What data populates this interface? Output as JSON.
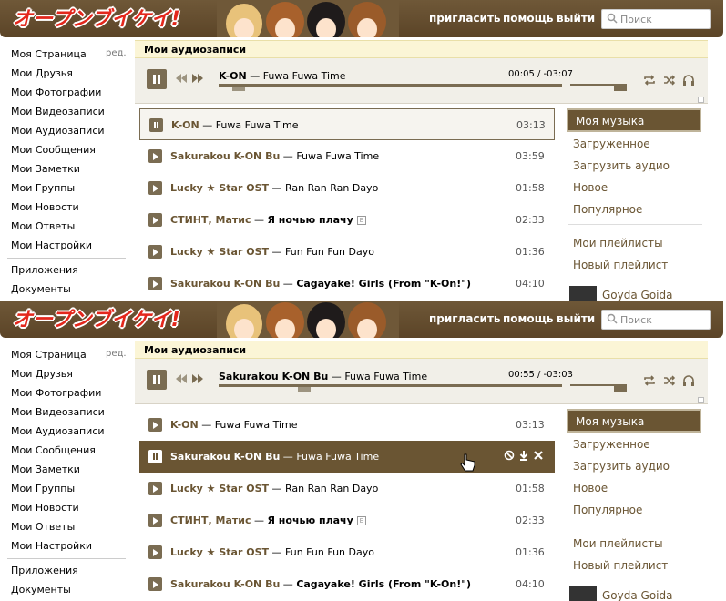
{
  "header": {
    "logo_text": "オープンブイケイ!",
    "nav": [
      {
        "label": "пригласить"
      },
      {
        "label": "помощь"
      },
      {
        "label": "выйти"
      }
    ],
    "search_placeholder": "Поиск"
  },
  "sidebar": {
    "edit_label": "ред.",
    "items": [
      {
        "label": "Моя Страница"
      },
      {
        "label": "Мои Друзья"
      },
      {
        "label": "Мои Фотографии"
      },
      {
        "label": "Мои Видеозаписи"
      },
      {
        "label": "Мои Аудиозаписи"
      },
      {
        "label": "Мои Сообщения"
      },
      {
        "label": "Мои Заметки"
      },
      {
        "label": "Мои Группы"
      },
      {
        "label": "Мои Новости"
      },
      {
        "label": "Мои Ответы"
      },
      {
        "label": "Мои Настройки"
      }
    ],
    "extra_items": [
      {
        "label": "Приложения"
      },
      {
        "label": "Документы"
      }
    ]
  },
  "page_title": "Мои аудиозаписи",
  "tracks": [
    {
      "artist": "K-ON",
      "title": "Fuwa Fuwa Time",
      "duration": "03:13"
    },
    {
      "artist": "Sakurakou K-ON Bu",
      "title": "Fuwa Fuwa Time",
      "duration": "03:59"
    },
    {
      "artist": "Lucky ★ Star OST",
      "title": "Ran Ran Ran Dayo",
      "duration": "01:58"
    },
    {
      "artist": "СТИНТ, Матис",
      "title": "Я ночью плачу",
      "duration": "02:33",
      "explicit": "E"
    },
    {
      "artist": "Lucky ★ Star OST",
      "title": "Fun Fun Fun Dayo",
      "duration": "01:36"
    },
    {
      "artist": "Sakurakou K-ON Bu",
      "title": "Cagayake! Girls (From \"K-On!\")",
      "duration": "04:10"
    }
  ],
  "right_menu": {
    "active": "Моя музыка",
    "items": [
      {
        "label": "Загруженное"
      },
      {
        "label": "Загрузить аудио"
      },
      {
        "label": "Новое"
      },
      {
        "label": "Популярное"
      }
    ],
    "playlist_items": [
      {
        "label": "Мои плейлисты"
      },
      {
        "label": "Новый плейлист"
      }
    ],
    "user": "Goyda Goida"
  },
  "states": [
    {
      "player_artist": "K-ON",
      "player_title": "Fuwa Fuwa Time",
      "player_time": "00:05 / -03:07",
      "progress": 0.04,
      "volume": 1.0,
      "current_track_index": 0,
      "hovered_track_index": -1
    },
    {
      "player_artist": "Sakurakou K-ON Bu",
      "player_title": "Fuwa Fuwa Time",
      "player_time": "00:55 / -03:03",
      "progress": 0.23,
      "volume": 1.0,
      "current_track_index": 1,
      "hovered_track_index": 1
    }
  ],
  "colors": {
    "header_bg": "#6f5838",
    "accent": "#6a5533",
    "logo_text": "#e3271c"
  },
  "icons": [
    "search-icon",
    "pause-icon",
    "play-icon",
    "prev-icon",
    "next-icon",
    "repeat-icon",
    "shuffle-icon",
    "headphones-icon",
    "block-icon",
    "download-icon",
    "delete-icon"
  ]
}
